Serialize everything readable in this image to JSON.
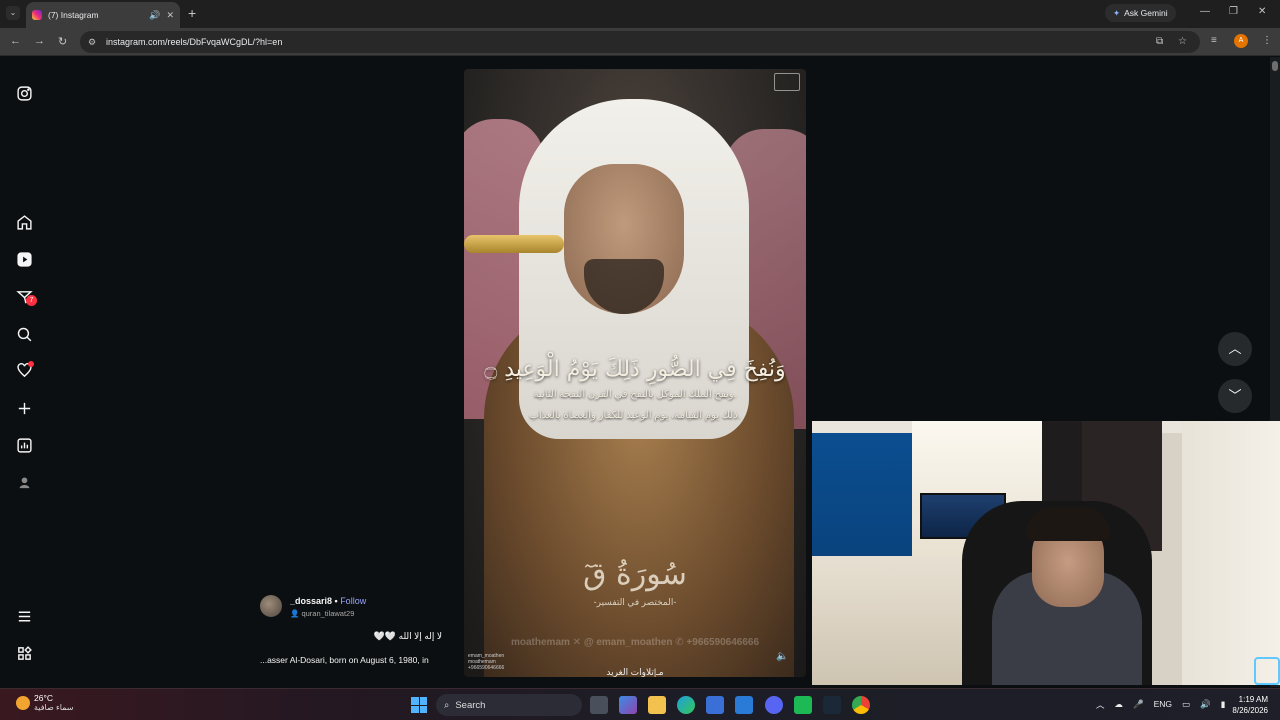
{
  "browser": {
    "tab_title": "(7) Instagram",
    "new_tab": "+",
    "gemini_label": "Ask Gemini",
    "url": "instagram.com/reels/DbFvqaWCgDL/?hl=en",
    "profile_initial": "A"
  },
  "sidebar": {
    "notifications_count": "7"
  },
  "reel": {
    "ayah": "وَنُفِخَ فِي الصُّورِ ذَلِكَ يَوْمُ الْوَعِيدِ ۝",
    "tafsir_line1": "ونفخ الملك الموكل بالنفخ في القرن النفخة الثانية.",
    "tafsir_line2": "ذلك يوم القيامة، يوم الوعيد للكفار والعصاة بالعذاب.",
    "surah": "سُورَةُ قٓ",
    "surah_sub": "-المختصر في التفسير-",
    "socials": "moathemam   ✕ @ emam_moathen   ✆ +966590646666",
    "bottom_text": "مـ|تلاوات الغريد",
    "credits_line1": "emam_moathen",
    "credits_line2": "moathemam",
    "credits_line3": "+966590646666"
  },
  "post": {
    "username": "_dossari8",
    "separator": " • ",
    "follow": "Follow",
    "audio": "quran_tilawat29",
    "caption_ar": "لا إله إلا الله 🤍🤍",
    "caption_en": "...asser Al-Dosari, born on August 6, 1980, in"
  },
  "taskbar": {
    "temperature": "26°C",
    "weather_text": "سماء صافية",
    "search_label": "Search",
    "lang": "ENG",
    "time": "1:19 AM",
    "date": "8/26/2026"
  }
}
